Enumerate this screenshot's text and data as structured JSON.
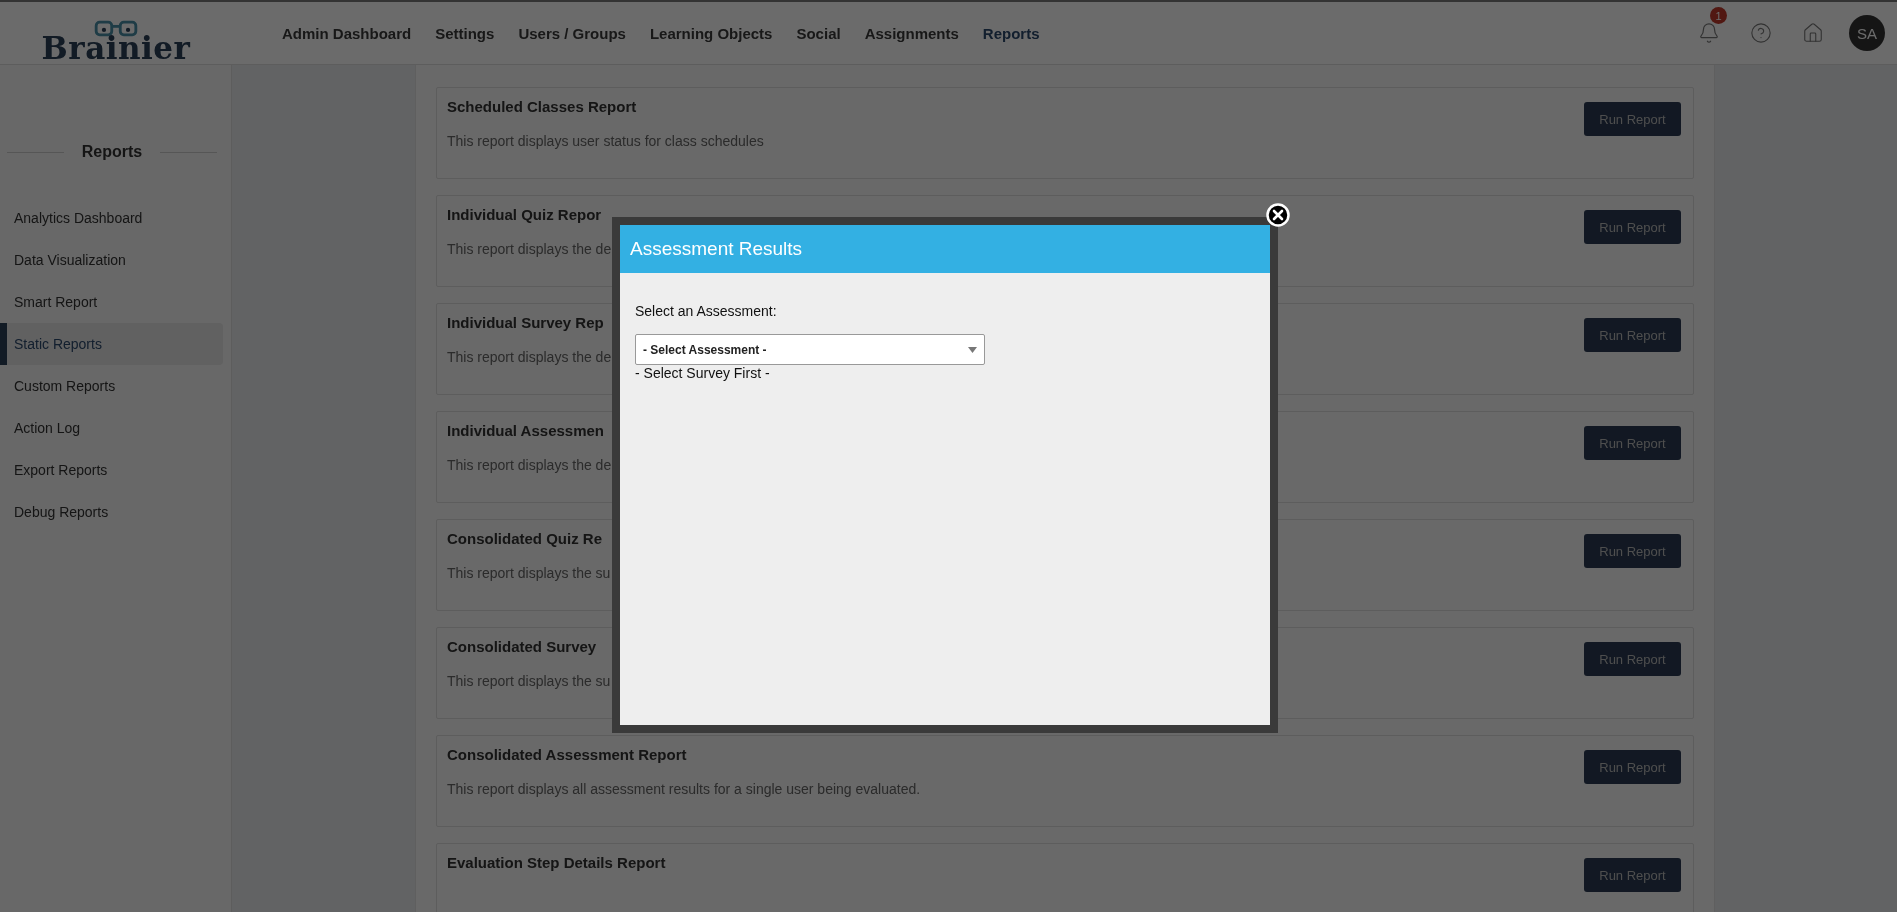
{
  "logo": {
    "text": "Brainier"
  },
  "nav": [
    {
      "label": "Admin Dashboard",
      "selected": false
    },
    {
      "label": "Settings",
      "selected": false
    },
    {
      "label": "Users / Groups",
      "selected": false
    },
    {
      "label": "Learning Objects",
      "selected": false
    },
    {
      "label": "Social",
      "selected": false
    },
    {
      "label": "Assignments",
      "selected": false
    },
    {
      "label": "Reports",
      "selected": true
    }
  ],
  "header_actions": {
    "notification_count": "1",
    "avatar": "SA"
  },
  "sidebar": {
    "title": "Reports",
    "items": [
      {
        "label": "Analytics Dashboard",
        "selected": false
      },
      {
        "label": "Data Visualization",
        "selected": false
      },
      {
        "label": "Smart Report",
        "selected": false
      },
      {
        "label": "Static Reports",
        "selected": true
      },
      {
        "label": "Custom Reports",
        "selected": false
      },
      {
        "label": "Action Log",
        "selected": false
      },
      {
        "label": "Export Reports",
        "selected": false
      },
      {
        "label": "Debug Reports",
        "selected": false
      }
    ]
  },
  "reports": [
    {
      "title": "Scheduled Classes Report",
      "description": "This report displays user status for class schedules",
      "button": "Run Report"
    },
    {
      "title": "Individual Quiz Repor",
      "description": "This report displays the de",
      "button": "Run Report"
    },
    {
      "title": "Individual Survey Rep",
      "description": "This report displays the de",
      "button": "Run Report"
    },
    {
      "title": "Individual Assessmen",
      "description": "This report displays the de",
      "button": "Run Report"
    },
    {
      "title": "Consolidated Quiz Re",
      "description": "This report displays the su",
      "button": "Run Report"
    },
    {
      "title": "Consolidated Survey",
      "description": "This report displays the su",
      "button": "Run Report"
    },
    {
      "title": "Consolidated Assessment Report",
      "description": "This report displays all assessment results for a single user being evaluated.",
      "button": "Run Report"
    },
    {
      "title": "Evaluation Step Details Report",
      "button": "Run Report"
    }
  ],
  "modal": {
    "title": "Assessment Results",
    "field_label": "Select an Assessment:",
    "select_value": "- Select Assessment -",
    "note": "- Select Survey First -"
  }
}
